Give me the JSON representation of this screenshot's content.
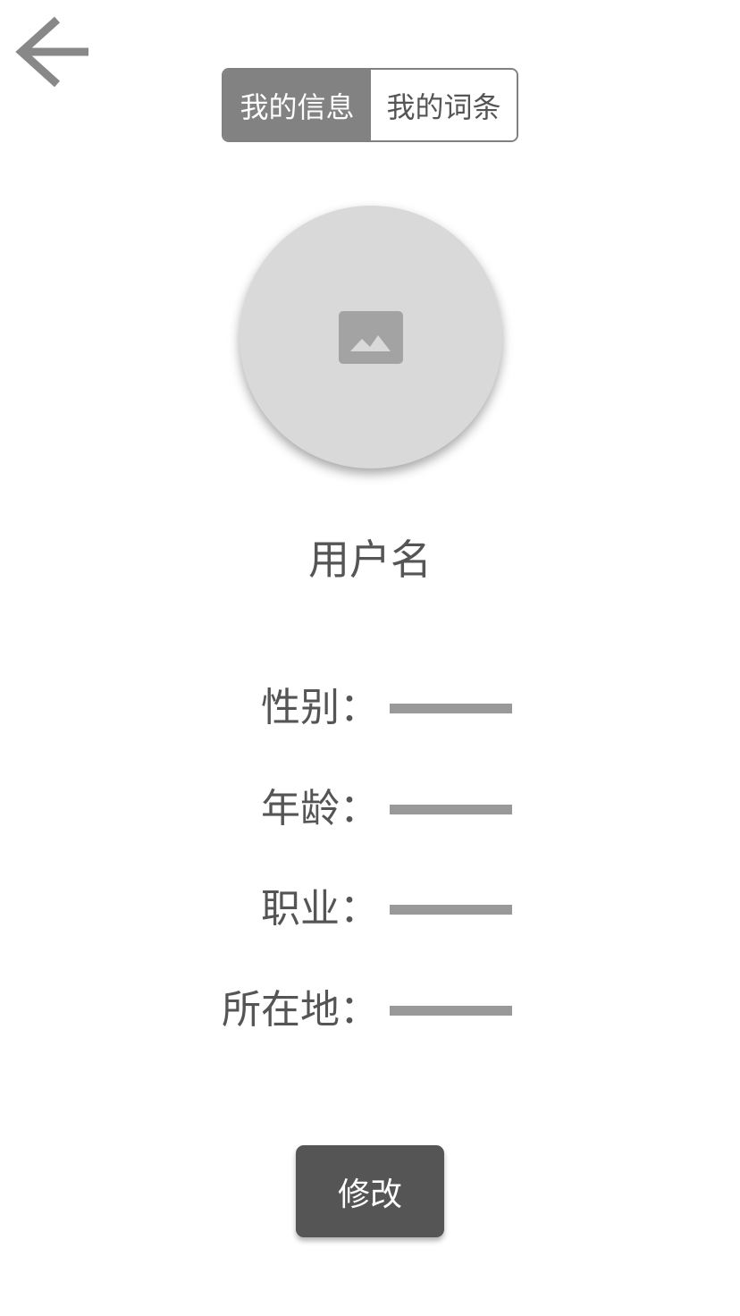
{
  "nav": {
    "back_icon": "arrow-left-icon"
  },
  "tabs": [
    {
      "label": "我的信息",
      "active": true
    },
    {
      "label": "我的词条",
      "active": false
    }
  ],
  "profile": {
    "avatar_icon": "image-placeholder-icon",
    "username": "用户名"
  },
  "fields": [
    {
      "label": "性别：",
      "value": ""
    },
    {
      "label": "年龄：",
      "value": ""
    },
    {
      "label": "职业：",
      "value": ""
    },
    {
      "label": "所在地：",
      "value": ""
    }
  ],
  "actions": {
    "edit_label": "修改"
  },
  "colors": {
    "active_tab_bg": "#828282",
    "avatar_bg": "#d9d9d9",
    "button_bg": "#555555",
    "placeholder_line": "#999999",
    "text": "#555555"
  }
}
